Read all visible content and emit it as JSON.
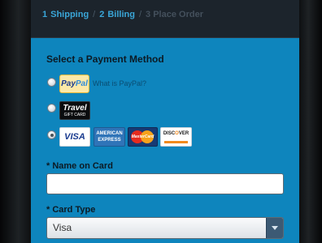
{
  "steps": [
    {
      "num": "1",
      "label": "Shipping",
      "state": "done"
    },
    {
      "num": "2",
      "label": "Billing",
      "state": "done"
    },
    {
      "num": "3",
      "label": "Place Order",
      "state": "inactive"
    }
  ],
  "step_separator": "/",
  "payment": {
    "title": "Select a Payment Method",
    "paypal_logo_pay": "Pay",
    "paypal_logo_pal": "Pal",
    "paypal_link": "What is PayPal?",
    "travel_logo_top": "Travel",
    "travel_logo_bottom": "GIFT CARD",
    "visa": "VISA",
    "amex_top": "AMERICAN",
    "amex_bottom": "EXPRESS",
    "mastercard": "MasterCard",
    "discover_start": "DISC",
    "discover_o": "O",
    "discover_end": "VER",
    "selected": "credit-card"
  },
  "name_field": {
    "label": "* Name on Card",
    "value": ""
  },
  "card_type": {
    "label": "* Card Type",
    "selected": "Visa"
  },
  "colors": {
    "panel": "#0e85bd",
    "header": "#1c242c",
    "step_active": "#3aa6d8"
  }
}
